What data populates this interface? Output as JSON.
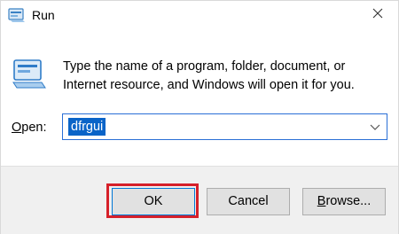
{
  "window": {
    "title": "Run",
    "title_icon": "run-icon",
    "close_icon": "close-icon"
  },
  "content": {
    "icon": "run-program-icon",
    "description": "Type the name of a program, folder, document, or Internet resource, and Windows will open it for you."
  },
  "open_field": {
    "label_mnemonic": "O",
    "label_rest": "pen:",
    "value": "dfrgui",
    "dropdown_icon": "chevron-down-icon"
  },
  "buttons": {
    "ok": "OK",
    "cancel": "Cancel",
    "browse_mnemonic": "B",
    "browse_rest": "rowse..."
  },
  "colors": {
    "selection": "#0a64c8",
    "focus_border": "#2a6fd6",
    "highlight_box": "#d6202a",
    "footer_bg": "#f0f0f0"
  }
}
